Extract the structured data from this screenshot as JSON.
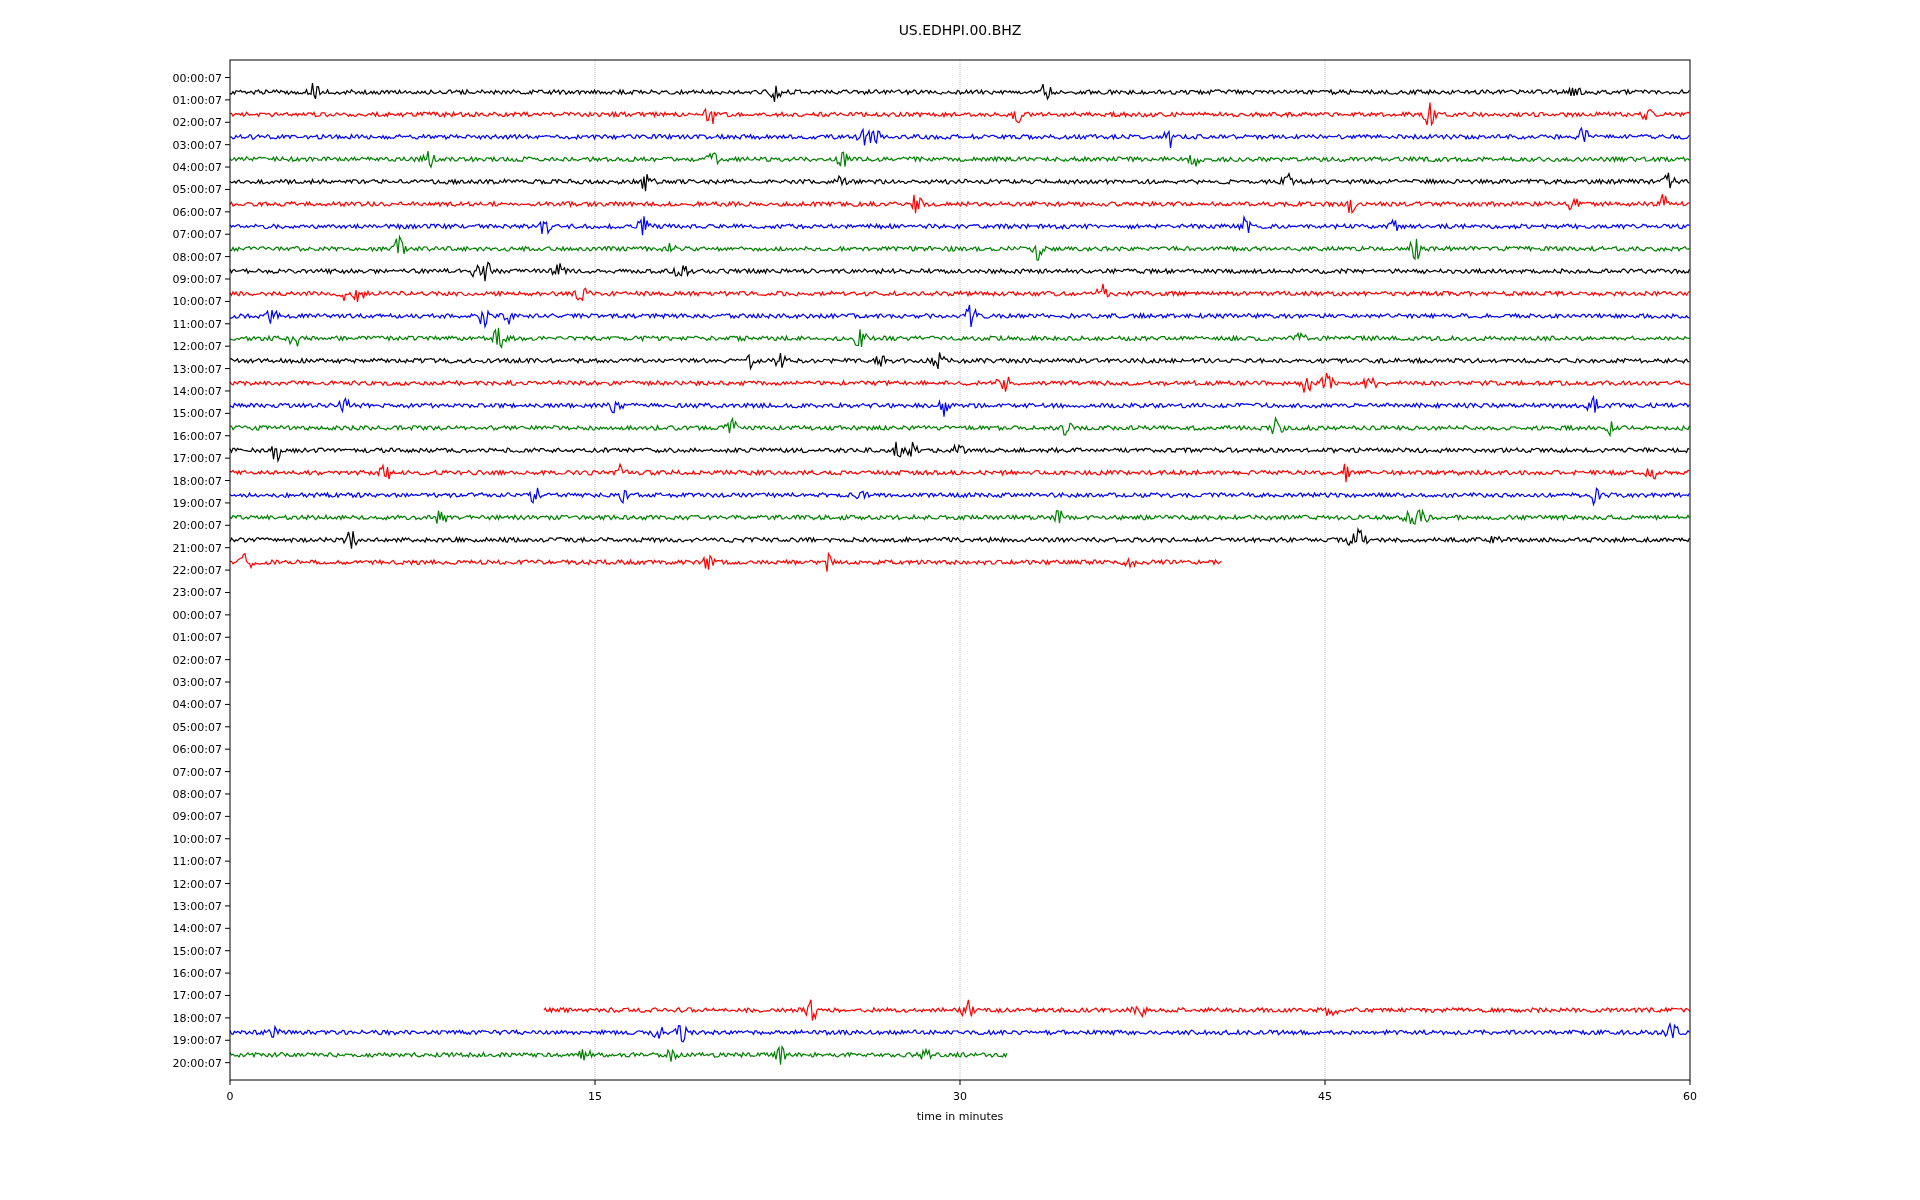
{
  "figure": {
    "title": "US.EDHPI.00.BHZ",
    "xlabel": "time in minutes",
    "xticks": [
      "0",
      "15",
      "30",
      "45",
      "60"
    ],
    "rows": [
      {
        "label": "00:00:07",
        "trace": {
          "color": "#000000",
          "kind": "from-start",
          "level": 1
        }
      },
      {
        "label": "01:00:07",
        "trace": {
          "color": "#ff0000",
          "kind": "from-start",
          "level": 1
        }
      },
      {
        "label": "02:00:07",
        "trace": {
          "color": "#0000ff",
          "kind": "from-start",
          "level": 1
        }
      },
      {
        "label": "03:00:07",
        "trace": {
          "color": "#008000",
          "kind": "from-start",
          "level": 1
        }
      },
      {
        "label": "04:00:07",
        "trace": {
          "color": "#000000",
          "kind": "from-start",
          "level": 1
        }
      },
      {
        "label": "05:00:07",
        "trace": {
          "color": "#ff0000",
          "kind": "from-start",
          "level": 1
        }
      },
      {
        "label": "06:00:07",
        "trace": {
          "color": "#0000ff",
          "kind": "from-start",
          "level": 1
        }
      },
      {
        "label": "07:00:07",
        "trace": {
          "color": "#008000",
          "kind": "from-start",
          "level": 1
        }
      },
      {
        "label": "08:00:07",
        "trace": {
          "color": "#000000",
          "kind": "from-start",
          "level": 1
        }
      },
      {
        "label": "09:00:07",
        "trace": {
          "color": "#ff0000",
          "kind": "from-start",
          "level": 1
        }
      },
      {
        "label": "10:00:07",
        "trace": {
          "color": "#0000ff",
          "kind": "from-start",
          "level": 1
        }
      },
      {
        "label": "11:00:07",
        "trace": {
          "color": "#008000",
          "kind": "from-start",
          "level": 1
        }
      },
      {
        "label": "12:00:07",
        "trace": {
          "color": "#000000",
          "kind": "from-start",
          "level": 1
        }
      },
      {
        "label": "13:00:07",
        "trace": {
          "color": "#ff0000",
          "kind": "from-start",
          "level": 1
        }
      },
      {
        "label": "14:00:07",
        "trace": {
          "color": "#0000ff",
          "kind": "from-start",
          "level": 1
        }
      },
      {
        "label": "15:00:07",
        "trace": {
          "color": "#008000",
          "kind": "from-start",
          "level": 1
        }
      },
      {
        "label": "16:00:07",
        "trace": {
          "color": "#000000",
          "kind": "from-start",
          "level": 1
        }
      },
      {
        "label": "17:00:07",
        "trace": {
          "color": "#ff0000",
          "kind": "from-start",
          "level": 1
        }
      },
      {
        "label": "18:00:07",
        "trace": {
          "color": "#0000ff",
          "kind": "from-start",
          "level": 1
        }
      },
      {
        "label": "19:00:07",
        "trace": {
          "color": "#008000",
          "kind": "from-start",
          "level": 1
        }
      },
      {
        "label": "20:00:07",
        "trace": {
          "color": "#000000",
          "kind": "from-start",
          "level": 1
        }
      },
      {
        "label": "21:00:07",
        "trace": {
          "color": "#ff0000",
          "kind": "from-start",
          "level": 0.68
        }
      },
      {
        "label": "22:00:07"
      },
      {
        "label": "23:00:07"
      },
      {
        "label": "00:00:07"
      },
      {
        "label": "01:00:07"
      },
      {
        "label": "02:00:07"
      },
      {
        "label": "03:00:07"
      },
      {
        "label": "04:00:07"
      },
      {
        "label": "05:00:07"
      },
      {
        "label": "06:00:07"
      },
      {
        "label": "07:00:07"
      },
      {
        "label": "08:00:07"
      },
      {
        "label": "09:00:07"
      },
      {
        "label": "10:00:07"
      },
      {
        "label": "11:00:07"
      },
      {
        "label": "12:00:07"
      },
      {
        "label": "13:00:07"
      },
      {
        "label": "14:00:07"
      },
      {
        "label": "15:00:07"
      },
      {
        "label": "16:00:07"
      },
      {
        "label": "17:00:07",
        "trace": {
          "color": "#ff0000",
          "kind": "to-end",
          "level": 0.785
        }
      },
      {
        "label": "18:00:07",
        "trace": {
          "color": "#0000ff",
          "kind": "from-start",
          "level": 1
        }
      },
      {
        "label": "19:00:07",
        "trace": {
          "color": "#008000",
          "kind": "from-start",
          "level": 0.533
        }
      },
      {
        "label": "20:00:07"
      }
    ]
  }
}
